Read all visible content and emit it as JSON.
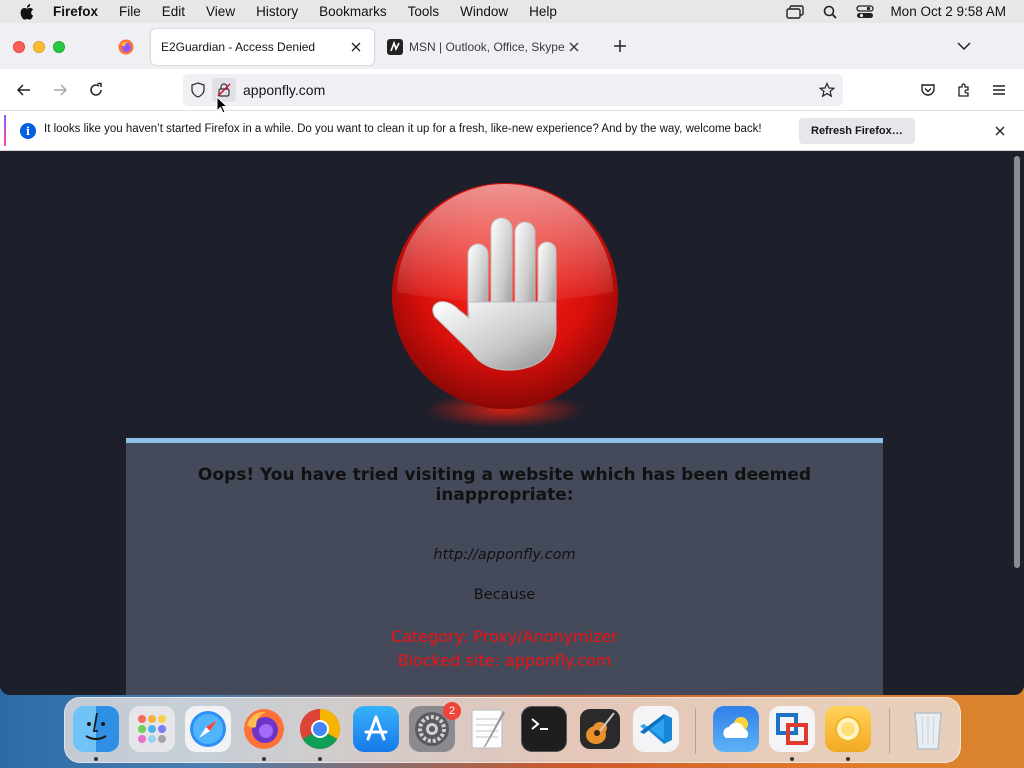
{
  "menubar": {
    "app_name": "Firefox",
    "items": [
      "File",
      "Edit",
      "View",
      "History",
      "Bookmarks",
      "Tools",
      "Window",
      "Help"
    ],
    "clock": "Mon Oct 2  9:58 AM"
  },
  "tabs": [
    {
      "title": "E2Guardian - Access Denied",
      "active": true
    },
    {
      "title": "MSN | Outlook, Office, Skype, B",
      "active": false
    }
  ],
  "urlbar": {
    "url": "apponfly.com"
  },
  "notification": {
    "text": "It looks like you haven’t started Firefox in a while. Do you want to clean it up for a fresh, like-new experience? And by the way, welcome back!",
    "button": "Refresh Firefox…"
  },
  "page": {
    "headline": "Oops! You have tried visiting a website which has been deemed inappropriate:",
    "blocked_url": "http://apponfly.com",
    "because": "Because",
    "category": "Category: Proxy/Anonymizer",
    "blocked_site": "Blocked site: apponfly.com"
  },
  "dock": {
    "apps": [
      "Finder",
      "Launchpad",
      "Safari",
      "Firefox",
      "Chrome",
      "App Store",
      "System Settings",
      "TextEdit",
      "Terminal",
      "GarageBand",
      "Visual Studio Code",
      "Weather",
      "VMware Fusion",
      "Sunlight",
      "Trash"
    ],
    "system_settings_badge": "2"
  },
  "colors": {
    "page_background": "#1d1f2a",
    "panel_background": "#454a5a",
    "panel_border": "#8fc2e8",
    "reason_text": "#ef1212"
  }
}
